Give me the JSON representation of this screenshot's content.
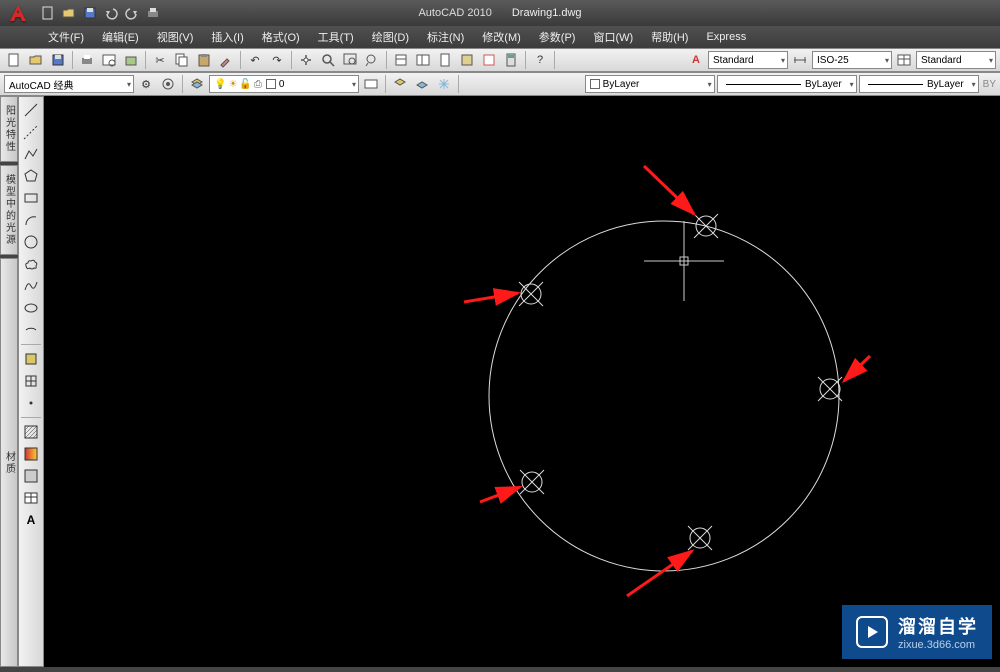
{
  "app": {
    "name": "AutoCAD 2010",
    "filename": "Drawing1.dwg"
  },
  "menus": [
    "文件(F)",
    "编辑(E)",
    "视图(V)",
    "插入(I)",
    "格式(O)",
    "工具(T)",
    "绘图(D)",
    "标注(N)",
    "修改(M)",
    "参数(P)",
    "窗口(W)",
    "帮助(H)",
    "Express"
  ],
  "workspace": {
    "label": "AutoCAD 经典"
  },
  "layer": {
    "current": "0"
  },
  "text_style": {
    "label": "Standard"
  },
  "dim_style": {
    "label": "ISO-25"
  },
  "table_style": {
    "label": "Standard"
  },
  "properties": {
    "color": "ByLayer",
    "linetype": "ByLayer",
    "lineweight": "ByLayer"
  },
  "side_tabs": [
    "阳光特性",
    "模型中的光源",
    "材质"
  ],
  "watermark": {
    "title": "溜溜自学",
    "url": "zixue.3d66.com"
  }
}
